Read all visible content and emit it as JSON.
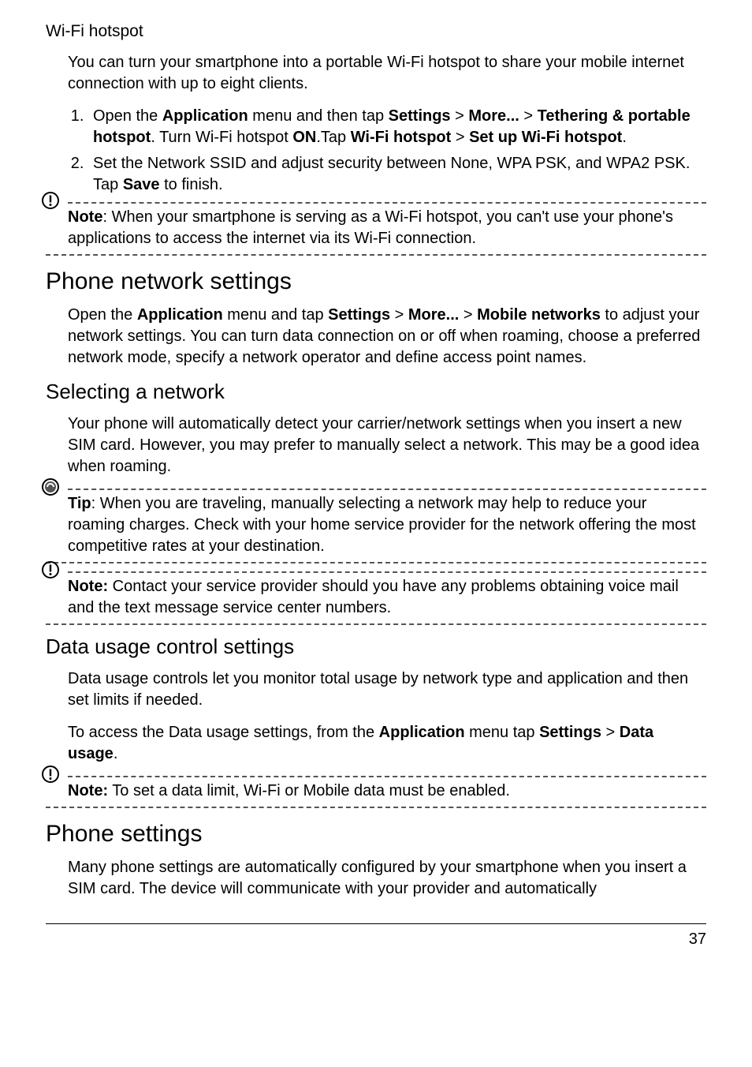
{
  "wifi_heading": "Wi-Fi hotspot",
  "wifi_intro": "You can turn your smartphone into a portable Wi-Fi hotspot to share your mobile internet connection with up to eight clients.",
  "ol1": {
    "pre1": "Open the ",
    "b1": "Application",
    "mid1": " menu and then tap ",
    "b2": "Settings",
    "gt1": " > ",
    "b3": "More...",
    "gt2": " > ",
    "b4": "Tethering & portable hotspot",
    "mid2": ". Turn Wi-Fi hotspot ",
    "b5": "ON",
    "mid3": ".Tap ",
    "b6": "Wi-Fi hotspot",
    "gt3": " > ",
    "b7": "Set up Wi-Fi hotspot",
    "end": "."
  },
  "ol2": {
    "pre": "Set the Network SSID and adjust security between None, WPA PSK, and WPA2 PSK. Tap ",
    "b": "Save",
    "end": " to finish."
  },
  "note1": {
    "label": "Note",
    "text": ": When your smartphone is serving as a Wi-Fi hotspot, you can't use your phone's applications to access the internet via its Wi-Fi connection."
  },
  "phone_net_heading": "Phone network settings",
  "phone_net_para": {
    "pre": "Open the ",
    "b1": "Application",
    "mid1": " menu and tap ",
    "b2": "Settings",
    "gt1": " > ",
    "b3": "More...",
    "gt2": " > ",
    "b4": "Mobile networks",
    "end": " to adjust your network settings. You can turn data connection on or off when roaming, choose a preferred network mode, specify a network operator and define access point names."
  },
  "select_net_heading": "Selecting a network",
  "select_net_para": "Your phone will automatically detect your carrier/network settings when you insert a new SIM card. However, you may prefer to manually select a network. This may be a good idea when roaming.",
  "tip": {
    "label": "Tip",
    "text": ": When you are traveling, manually selecting a network may help to reduce your roaming charges. Check with your home service provider for the network offering the most competitive rates at your destination."
  },
  "note2": {
    "label": "Note:",
    "text": " Contact your service provider should you have any problems obtaining voice mail and the text message service center numbers."
  },
  "data_usage_heading": "Data usage control settings",
  "data_usage_para1": "Data usage controls let you monitor total usage by network type and application and then set limits if needed.",
  "data_usage_para2": {
    "pre": "To access the Data usage settings, from the ",
    "b1": "Application",
    "mid": " menu tap ",
    "b2": "Settings",
    "gt": " > ",
    "b3": "Data usage",
    "end": "."
  },
  "note3": {
    "label": "Note:",
    "text": " To set a data limit, Wi-Fi or Mobile data must be enabled."
  },
  "phone_settings_heading": "Phone settings",
  "phone_settings_para": "Many phone settings are automatically configured by your smartphone when you insert a SIM card. The device will communicate with your provider and automatically",
  "page_number": "37"
}
